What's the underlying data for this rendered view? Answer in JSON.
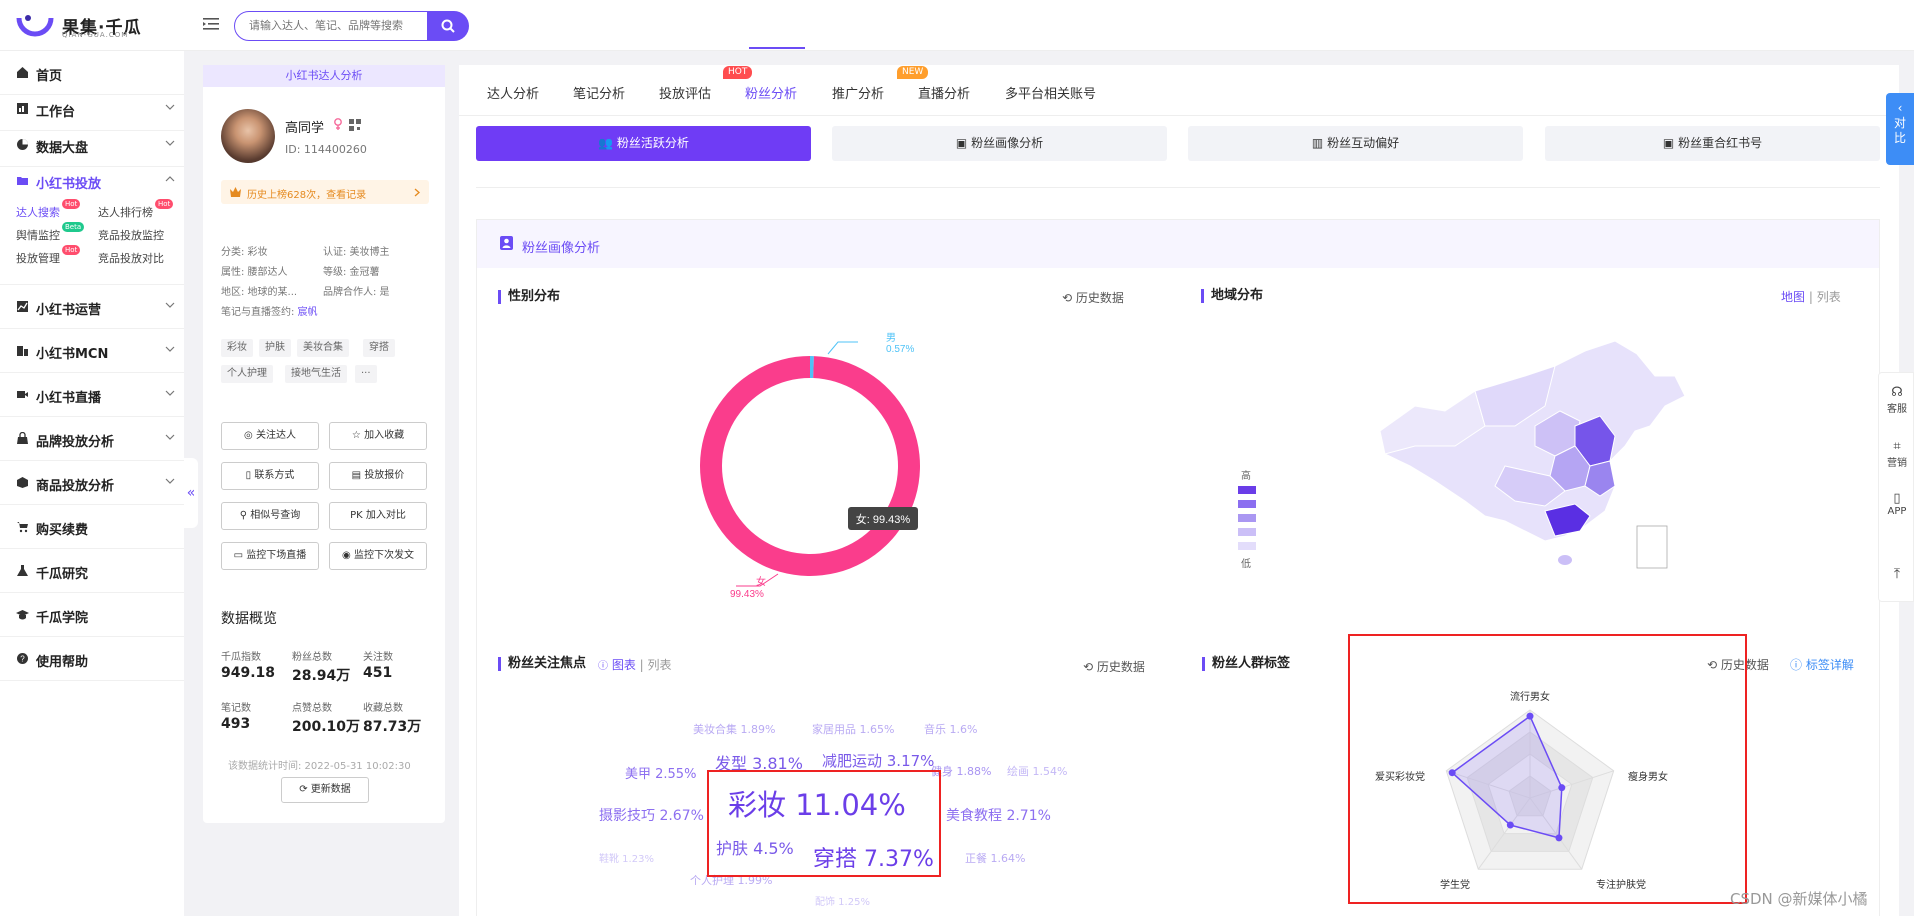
{
  "header": {
    "logo_title": "果集·千瓜",
    "logo_sub": "QIAN-GUA.COM",
    "search_placeholder": "请输入达人、笔记、品牌等搜索"
  },
  "nav": {
    "home": "首页",
    "workbench": "工作台",
    "data_screen": "数据大盘",
    "xhs_ads": "小红书投放",
    "sub": {
      "talent_search": "达人搜索",
      "talent_rank": "达人排行榜",
      "sentiment": "舆情监控",
      "competitor_monitor": "竞品投放监控",
      "ad_manage": "投放管理",
      "competitor_compare": "竞品投放对比",
      "hot": "Hot",
      "beta": "Beta"
    },
    "xhs_ops": "小红书运营",
    "xhs_mcn": "小红书MCN",
    "xhs_live": "小红书直播",
    "brand_analysis": "品牌投放分析",
    "goods_analysis": "商品投放分析",
    "renew": "购买续费",
    "research": "千瓜研究",
    "academy": "千瓜学院",
    "help": "使用帮助",
    "collapse": "«"
  },
  "profile": {
    "banner": "小红书达人分析",
    "name": "高同学",
    "id": "ID:  114400260",
    "rank_text": "历史上榜628次，查看记录",
    "info": {
      "category": "分类: 彩妆",
      "cert": "认证: 美妆博主",
      "attr": "属性: 腰部达人",
      "level": "等级: 金冠薯",
      "region": "地区: 地球的某...",
      "brand_partner": "品牌合作人: 是",
      "sign_label": "笔记与直播签约: ",
      "sign_value": "宸帆"
    },
    "tags": [
      "彩妆",
      "护肤",
      "美妆合集",
      "穿搭",
      "个人护理",
      "接地气生活",
      "···"
    ],
    "buttons": {
      "follow": "关注达人",
      "favorite": "加入收藏",
      "contact": "联系方式",
      "quote": "投放报价",
      "similar": "相似号查询",
      "pk": "PK 加入对比",
      "monitor_live": "监控下场直播",
      "monitor_post": "监控下次发文"
    },
    "overview_title": "数据概览",
    "stats": [
      {
        "label": "千瓜指数",
        "value": "949.18"
      },
      {
        "label": "粉丝总数",
        "value": "28.94万"
      },
      {
        "label": "关注数",
        "value": "451"
      },
      {
        "label": "笔记数",
        "value": "493"
      },
      {
        "label": "点赞总数",
        "value": "200.10万"
      },
      {
        "label": "收藏总数",
        "value": "87.73万"
      }
    ],
    "stat_time": "该数据统计时间: 2022-05-31 10:02:30",
    "refresh": "更新数据"
  },
  "tabs": [
    "达人分析",
    "笔记分析",
    "投放评估",
    "粉丝分析",
    "推广分析",
    "直播分析",
    "多平台相关账号"
  ],
  "tab_badges": {
    "hot": "HOT",
    "new": "NEW"
  },
  "active_tab": "粉丝分析",
  "subtabs": [
    "粉丝活跃分析",
    "粉丝画像分析",
    "粉丝互动偏好",
    "粉丝重合红书号"
  ],
  "section_title": "粉丝画像分析",
  "gender": {
    "title": "性别分布",
    "history": "历史数据",
    "male_label": "男",
    "male_pct": "0.57%",
    "female_label": "女",
    "female_pct": "99.43%",
    "tooltip": "女: 99.43%",
    "male_value": 0.57,
    "female_value": 99.43,
    "male_color": "#4fc3f7",
    "female_color": "#fa3d8c"
  },
  "region": {
    "title": "地域分布",
    "view_map": "地图",
    "view_list": "列表",
    "legend_high": "高",
    "legend_low": "低"
  },
  "focus": {
    "title": "粉丝关注焦点",
    "view_chart": "图表",
    "view_list": "列表",
    "history": "历史数据",
    "words": [
      {
        "text": "美妆合集 1.89%"
      },
      {
        "text": "家居用品 1.65%"
      },
      {
        "text": "音乐 1.6%"
      },
      {
        "text": "美甲 2.55%"
      },
      {
        "text": "发型 3.81%"
      },
      {
        "text": "减肥运动 3.17%"
      },
      {
        "text": "健身 1.88%"
      },
      {
        "text": "绘画 1.54%"
      },
      {
        "text": "彩妆 11.04%"
      },
      {
        "text": "摄影技巧 2.67%"
      },
      {
        "text": "美食教程 2.71%"
      },
      {
        "text": "护肤 4.5%"
      },
      {
        "text": "穿搭 7.37%"
      },
      {
        "text": "鞋靴 1.23%"
      },
      {
        "text": "正餐 1.64%"
      },
      {
        "text": "个人护理 1.99%"
      },
      {
        "text": "配饰 1.25%"
      }
    ]
  },
  "tags_card": {
    "title": "粉丝人群标签",
    "history": "历史数据",
    "detail": "标签详解",
    "radar_labels": [
      "流行男女",
      "瘦身男女",
      "专注护肤党",
      "学生党",
      "爱买彩妆党"
    ],
    "radar_values": [
      0.93,
      0.38,
      0.56,
      0.38,
      0.93
    ]
  },
  "side": {
    "compare": "对比",
    "service": "客服",
    "marketing": "营销",
    "app": "APP"
  },
  "watermark": "CSDN @新媒体小橘"
}
